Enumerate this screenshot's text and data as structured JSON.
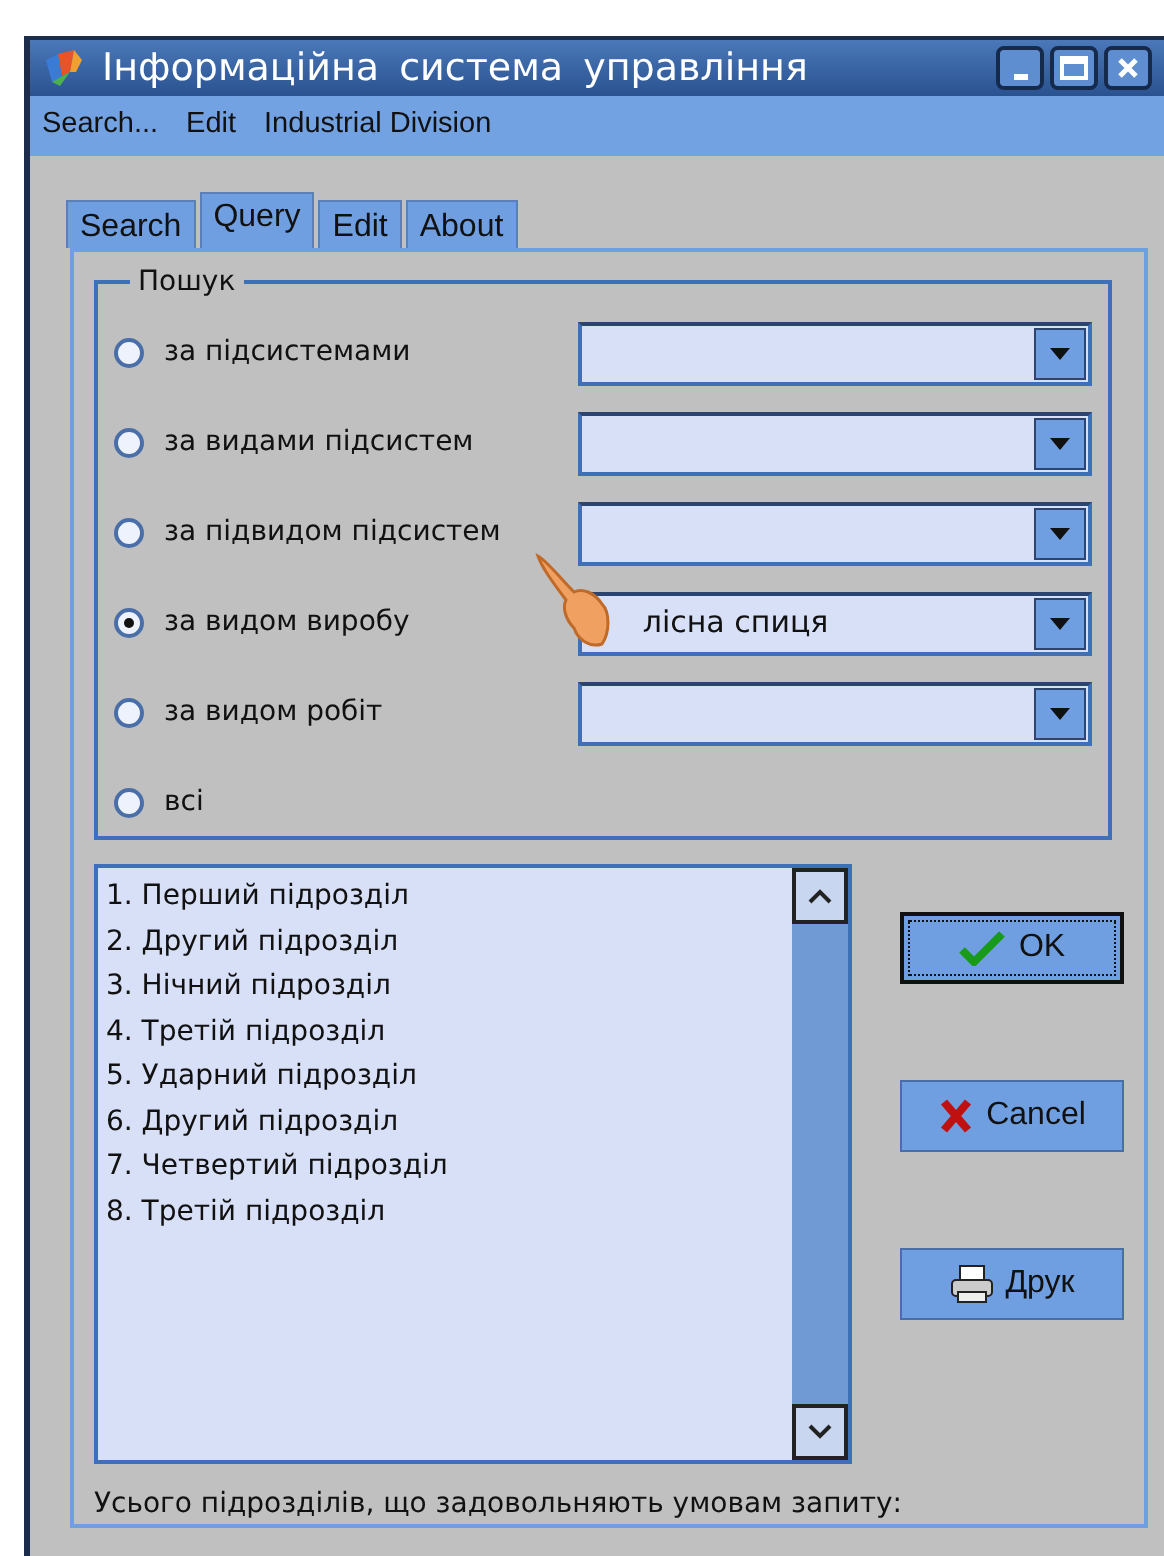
{
  "window": {
    "title": "Інформаційна система управління"
  },
  "menu": [
    "Search...",
    "Edit",
    "Industrial Division"
  ],
  "tabs": [
    {
      "label": "Search",
      "selected": false
    },
    {
      "label": "Query",
      "selected": true
    },
    {
      "label": "Edit",
      "selected": false
    },
    {
      "label": "About",
      "selected": false
    }
  ],
  "search_group": {
    "title": "Пошук",
    "options": [
      {
        "kind": "combo",
        "label": "за підсистемами",
        "selected": false
      },
      {
        "kind": "combo",
        "label": "за видами підсистем",
        "selected": false
      },
      {
        "kind": "combo",
        "label": "за підвидом підсистем",
        "selected": false
      },
      {
        "kind": "combo",
        "label": "за видом виробу",
        "selected": true,
        "value": "лісна спиця"
      },
      {
        "kind": "combo",
        "label": "за видом робіт",
        "selected": false
      },
      {
        "kind": "plain",
        "label": "всі",
        "selected": false
      }
    ]
  },
  "results": [
    "1. Перший підрозділ",
    "2. Другий підрозділ",
    "3. Нічний підрозділ",
    "4. Третій підрозділ",
    "5. Ударний підрозділ",
    "6. Другий підрозділ",
    "7. Четвертий підрозділ",
    "8. Третій підрозділ"
  ],
  "buttons": [
    {
      "kind": "ok",
      "label": "OK"
    },
    {
      "kind": "cancel",
      "label": "Cancel"
    },
    {
      "kind": "print",
      "label": "Друк"
    }
  ],
  "status_text": "Усього підрозділів, що задовольняють умовам запиту:"
}
